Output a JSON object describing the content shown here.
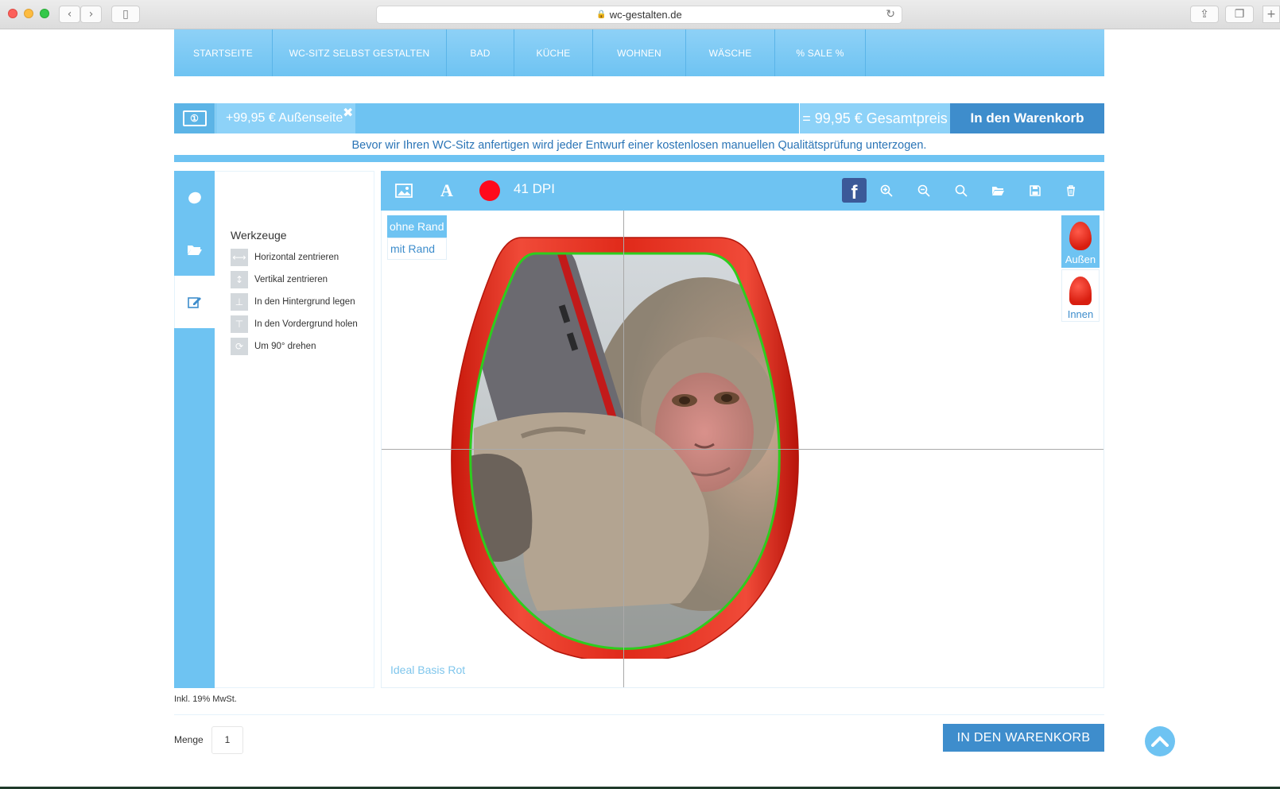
{
  "browser": {
    "url": "wc-gestalten.de"
  },
  "nav": {
    "items": [
      {
        "label": "STARTSEITE"
      },
      {
        "label": "WC-SITZ SELBST GESTALTEN"
      },
      {
        "label": "BAD"
      },
      {
        "label": "KÜCHE"
      },
      {
        "label": "WOHNEN"
      },
      {
        "label": "WÄSCHE"
      },
      {
        "label": "% SALE %"
      }
    ]
  },
  "price": {
    "item_label": "+99,95 € Außenseite",
    "remove_icon": "close-icon",
    "total_label": "= 99,95 € Gesamtpreis",
    "cart_button": "In den Warenkorb"
  },
  "notice": "Bevor wir Ihren WC-Sitz anfertigen wird jeder Entwurf einer kostenlosen manuellen Qualitätsprüfung unterzogen.",
  "sidetabs": [
    {
      "icon": "egg-shape-icon",
      "active": false
    },
    {
      "icon": "folder-open-icon",
      "active": false
    },
    {
      "icon": "edit-icon",
      "active": true
    }
  ],
  "tools": {
    "title": "Werkzeuge",
    "items": [
      {
        "label": "Horizontal zentrieren",
        "icon": "horizontal-center-icon"
      },
      {
        "label": "Vertikal zentrieren",
        "icon": "vertical-center-icon"
      },
      {
        "label": "In den Hintergrund legen",
        "icon": "send-to-back-icon"
      },
      {
        "label": "In den Vordergrund holen",
        "icon": "bring-to-front-icon"
      },
      {
        "label": "Um 90° drehen",
        "icon": "rotate-icon"
      }
    ]
  },
  "editor": {
    "dpi_label": "41 DPI",
    "selected_color": "#ff0a1c",
    "border_options": {
      "without": "ohne Rand",
      "with": "mit Rand",
      "selected": "ohne Rand"
    },
    "product_name": "Ideal Basis Rot",
    "side_options": [
      {
        "label": "Außen",
        "selected": true
      },
      {
        "label": "Innen",
        "selected": false
      }
    ],
    "toolbar_icons": [
      "image-icon",
      "text-icon",
      "color-icon",
      "facebook-icon",
      "zoom-in-icon",
      "zoom-out-icon",
      "zoom-reset-icon",
      "open-folder-icon",
      "save-icon",
      "trash-icon"
    ]
  },
  "footer": {
    "vat": "Inkl. 19% MwSt.",
    "quantity_label": "Menge",
    "quantity_value": "1",
    "cart_button": "IN DEN WARENKORB"
  },
  "colors": {
    "accent": "#6ec3f2",
    "accent_dark": "#3e8dcc",
    "seat_red": "#e02a1a",
    "guide_green": "#2ecc1e"
  }
}
